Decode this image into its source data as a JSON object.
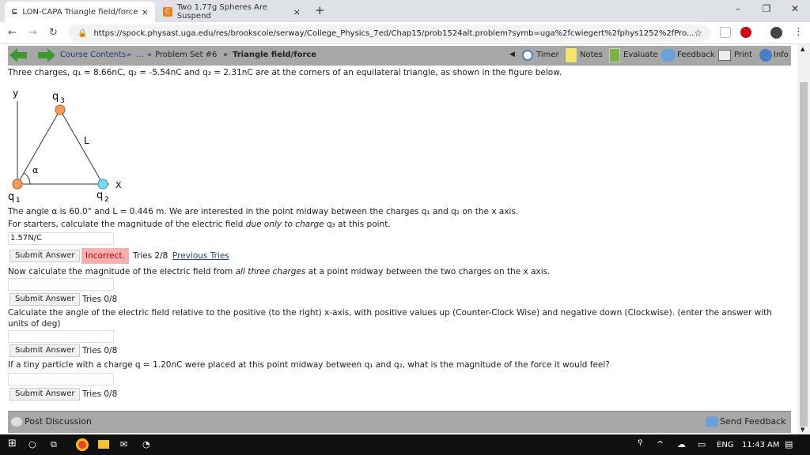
{
  "browser": {
    "tabs": [
      {
        "label": "LON-CAPA Triangle field/force",
        "close": "×"
      },
      {
        "label": "Two 1.77g Spheres Are Suspend",
        "close": "×"
      }
    ],
    "new_tab": "+",
    "url": "https://spock.physast.uga.edu/res/brookscole/serway/College_Physics_7ed/Chap15/prob1524alt.problem?symb=uga%2fcwiegert%2fphys1252%2fPro...",
    "controls": {
      "min": "–",
      "max": "❐",
      "close": "✕"
    }
  },
  "lonnav": {
    "course": "Course Contents",
    "sep1": "»",
    "ellipsis": "...",
    "sep2": "»",
    "pset": "Problem Set #6",
    "sep3": "»",
    "title": "Triangle field/force",
    "items": [
      "Timer",
      "Notes",
      "Evaluate",
      "Feedback",
      "Print",
      "Info"
    ]
  },
  "problem": {
    "intro": "Three charges, q₁ = 8.66nC, q₂ = -5.54nC and q₃ = 2.31nC are at the corners of an equilateral triangle, as shown in the figure below.",
    "fig": {
      "y": "y",
      "x": "X",
      "q3": "q",
      "q3sub": "3",
      "q1": "q",
      "q1sub": "1",
      "q2": "q",
      "q2sub": "2",
      "L": "L",
      "alpha": "α"
    },
    "line2": "The angle α is 60.0° and L = 0.446 m. We are interested in the point midway between the charges q₁ and q₂ on the x axis.",
    "line3a": "For starters, calculate the magnitude of the electric field ",
    "line3b": "due only to charge",
    "line3c": " q₃ at this point.",
    "answer1": "1.57N/C",
    "submit": "Submit Answer",
    "incorrect": "Incorrect.",
    "tries1": "Tries 2/8",
    "previous": "Previous Tries",
    "q2a": "Now calculate the magnitude of the electric field from ",
    "q2b": "all three charges",
    "q2c": " at a point midway between the two charges on the x axis.",
    "tries2": "Tries 0/8",
    "q3line1": "Calculate the angle of the electric field relative to the positive (to the right) x-axis, with positive values up (Counter-Clock Wise) and negative down (Clockwise). (enter the answer with",
    "q3line2": "units of deg)",
    "tries3": "Tries 0/8",
    "q4": "If a tiny particle with a charge q = 1.20nC were placed at this point midway between q₁ and q₂, what is the magnitude of the force it would feel?",
    "tries4": "Tries 0/8"
  },
  "footer": {
    "post": "Post Discussion",
    "send": "Send Feedback"
  },
  "taskbar": {
    "lang": "ENG",
    "time": "11:43 AM"
  }
}
